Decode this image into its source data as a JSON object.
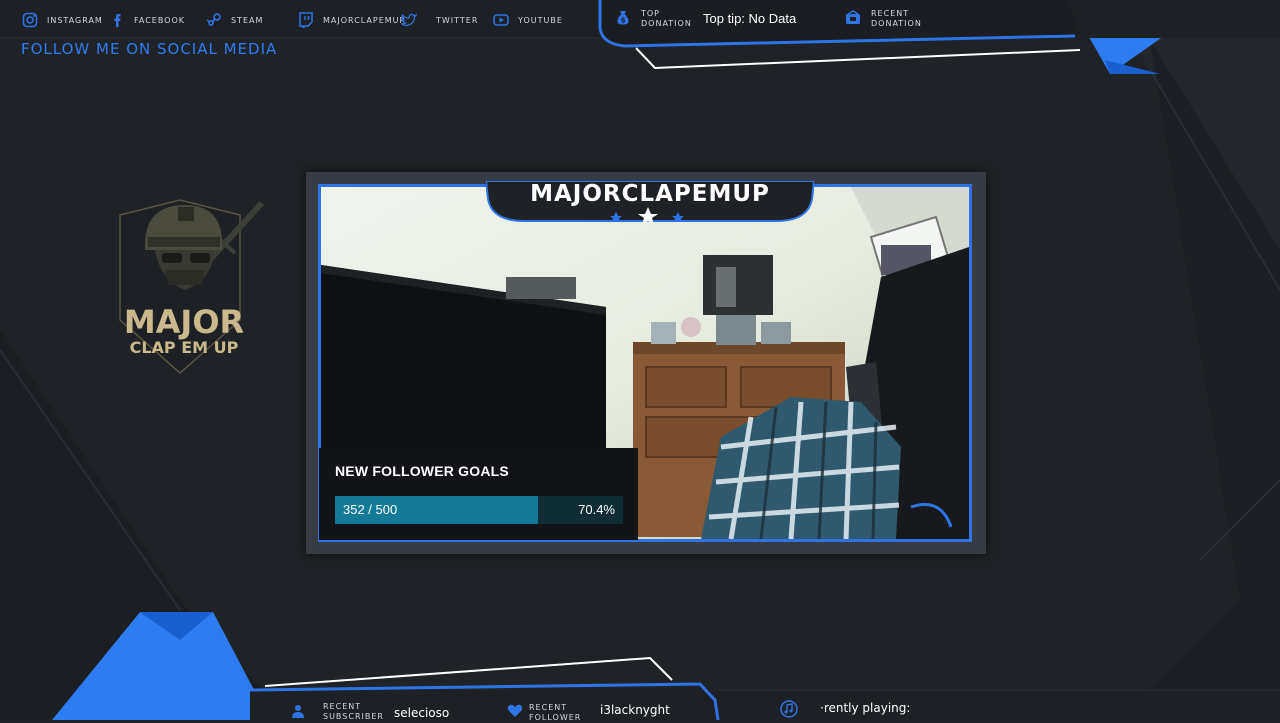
{
  "social": {
    "items": [
      {
        "icon": "instagram-icon",
        "label": "INSTAGRAM"
      },
      {
        "icon": "facebook-icon",
        "label": "FACEBOOK"
      },
      {
        "icon": "steam-icon",
        "label": "STEAM"
      },
      {
        "icon": "twitch-icon",
        "label": "MAJORCLAPEMUP"
      },
      {
        "icon": "twitter-icon",
        "label": "TWITTER"
      },
      {
        "icon": "youtube-icon",
        "label": "YOUTUBE"
      }
    ],
    "follow_title": "FOLLOW ME ON SOCIAL MEDIA"
  },
  "top_panel": {
    "top_donation_label_1": "TOP",
    "top_donation_label_2": "DONATION",
    "top_tip": "Top tip: No Data",
    "recent_donation_label_1": "RECENT",
    "recent_donation_label_2": "DONATION"
  },
  "logo": {
    "line1": "MAJOR",
    "line2": "CLAP EM UP"
  },
  "camera": {
    "name": "MAJORCLAPEMUP"
  },
  "goal": {
    "title": "NEW FOLLOWER GOALS",
    "count": "352 / 500",
    "percent_text": "70.4%",
    "progress": 0.704
  },
  "bottom": {
    "recent_subscriber_label_1": "RECENT",
    "recent_subscriber_label_2": "SUBSCRIBER",
    "recent_subscriber": "selecioso",
    "recent_follower_label_1": "RECENT",
    "recent_follower_label_2": "FOLLOWER",
    "recent_follower": "i3lacknyght",
    "now_playing": "·rently playing:"
  },
  "colors": {
    "background": "#1f2226",
    "accent_blue": "#2f74e6",
    "goal_fill": "#137a98",
    "goal_track": "#0f2d33",
    "logo_gold": "#c9b98d"
  }
}
